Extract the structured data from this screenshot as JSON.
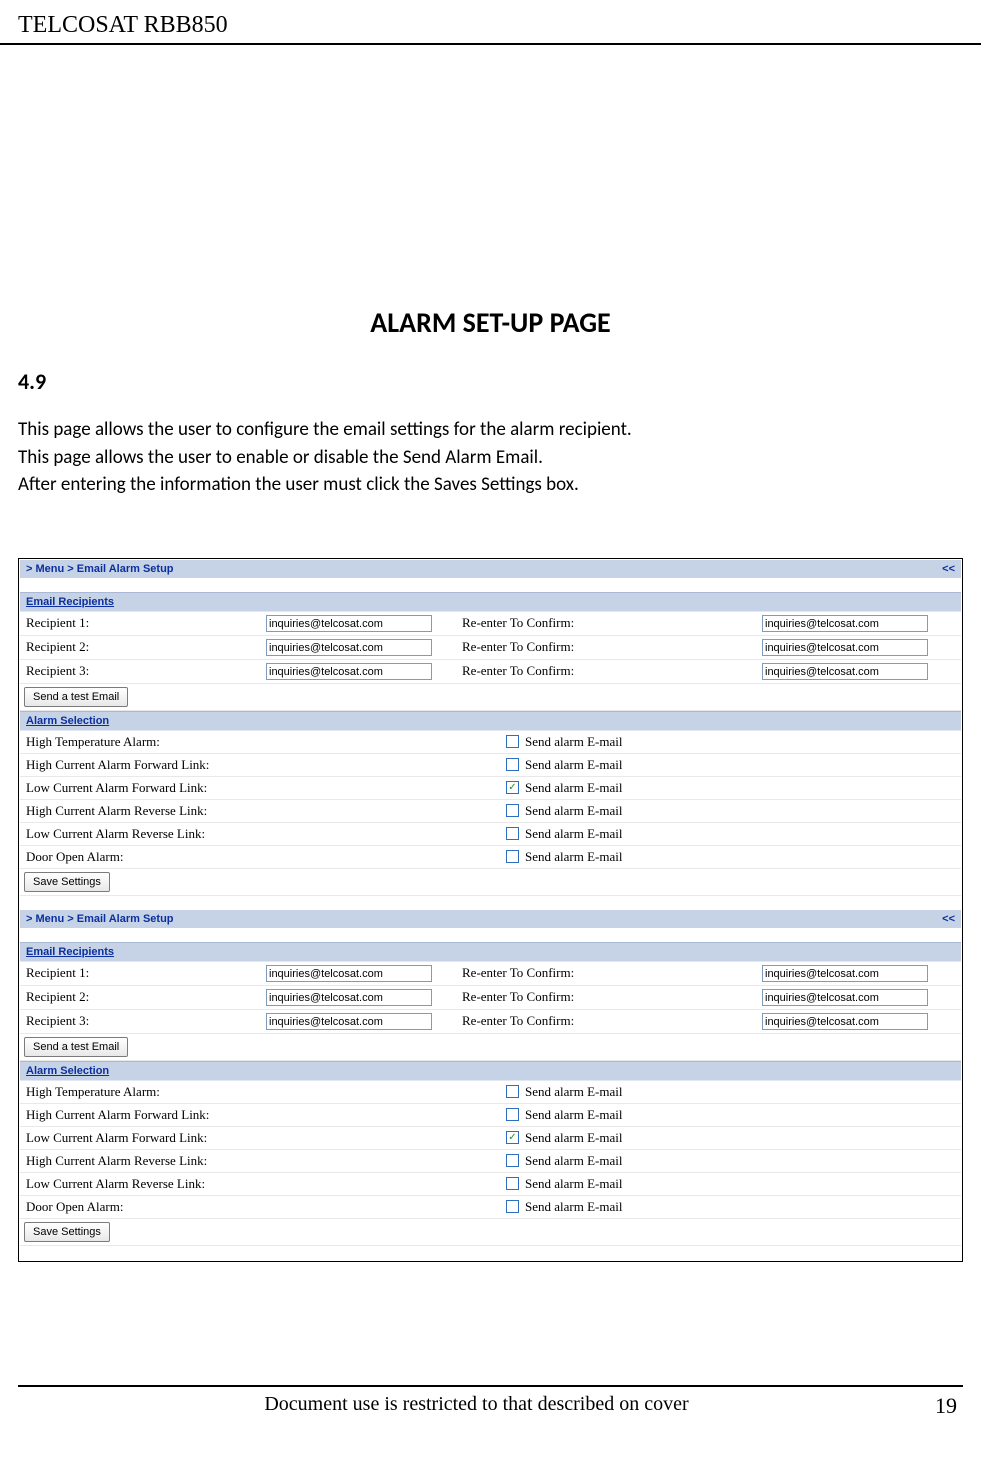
{
  "header": {
    "product": "TELCOSAT RBB850"
  },
  "title": "ALARM SET-UP PAGE",
  "section": "4.9",
  "paragraphs": [
    "This page allows the user to configure the email settings for the alarm recipient.",
    "This page allows the user to enable or disable the Send Alarm Email.",
    "After entering the information the user must click the Saves Settings box."
  ],
  "panel": {
    "breadcrumb_left": "> Menu > Email Alarm Setup",
    "breadcrumb_right": "<<",
    "section_recipients": "Email Recipients",
    "recipients": [
      {
        "label": "Recipient 1:",
        "value": "inquiries@telcosat.com",
        "confirm_label": "Re-enter To Confirm:",
        "confirm_value": "inquiries@telcosat.com"
      },
      {
        "label": "Recipient 2:",
        "value": "inquiries@telcosat.com",
        "confirm_label": "Re-enter To Confirm:",
        "confirm_value": "inquiries@telcosat.com"
      },
      {
        "label": "Recipient 3:",
        "value": "inquiries@telcosat.com",
        "confirm_label": "Re-enter To Confirm:",
        "confirm_value": "inquiries@telcosat.com"
      }
    ],
    "send_test_btn": "Send a test Email",
    "section_alarm": "Alarm Selection",
    "alarm_checkbox_label": "Send alarm E-mail",
    "alarms": [
      {
        "label": "High Temperature Alarm:",
        "checked": false
      },
      {
        "label": "High Current Alarm Forward Link:",
        "checked": false
      },
      {
        "label": "Low Current Alarm Forward Link:",
        "checked": true
      },
      {
        "label": "High Current Alarm Reverse Link:",
        "checked": false
      },
      {
        "label": "Low Current Alarm Reverse Link:",
        "checked": false
      },
      {
        "label": "Door Open Alarm:",
        "checked": false
      }
    ],
    "save_btn": "Save Settings"
  },
  "footer": {
    "text": "Document use is restricted to that described on cover",
    "page": "19"
  }
}
